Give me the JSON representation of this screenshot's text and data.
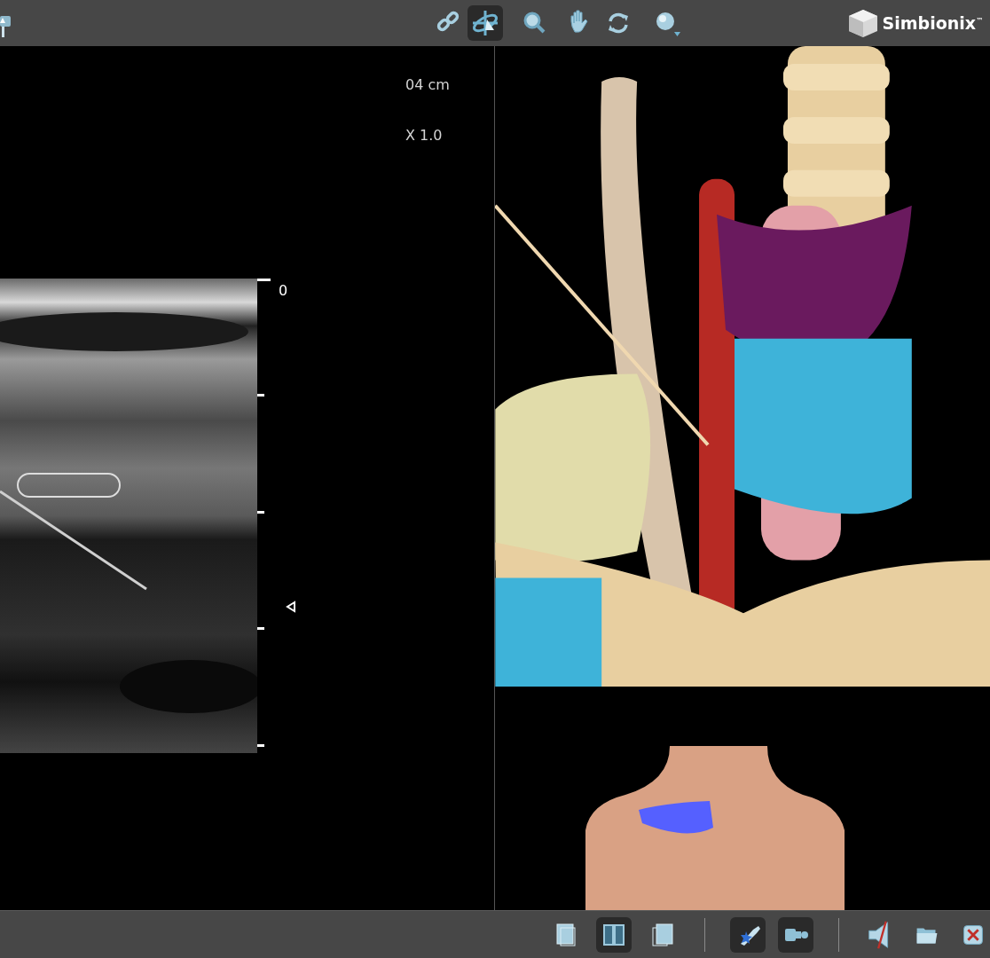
{
  "top_toolbar": {
    "left_tools": [
      {
        "kind": "pin",
        "selected": false
      }
    ],
    "tools": [
      {
        "kind": "link",
        "selected": false
      },
      {
        "kind": "crosshair",
        "selected": true
      },
      {
        "kind": "zoom",
        "selected": false
      },
      {
        "kind": "hand",
        "selected": false
      },
      {
        "kind": "rotate",
        "selected": false
      },
      {
        "kind": "sphere",
        "selected": false
      }
    ],
    "logo": "Simbionix$^{™}$"
  },
  "ultrasound_view": {
    "depth": "04 cm",
    "zoom": "X 1.0",
    "scale_label": "0"
  },
  "bottom_toolbar": {
    "groups": [
      [
        {
          "kind": "single-view",
          "selected": false
        },
        {
          "kind": "split-view",
          "selected": true
        },
        {
          "kind": "overlay-view",
          "selected": false
        }
      ],
      [
        {
          "kind": "probe",
          "selected": true
        },
        {
          "kind": "needle-guide",
          "selected": true
        }
      ],
      [
        {
          "kind": "mute",
          "selected": false
        },
        {
          "kind": "folder",
          "selected": false
        },
        {
          "kind": "close",
          "selected": false
        }
      ]
    ]
  }
}
